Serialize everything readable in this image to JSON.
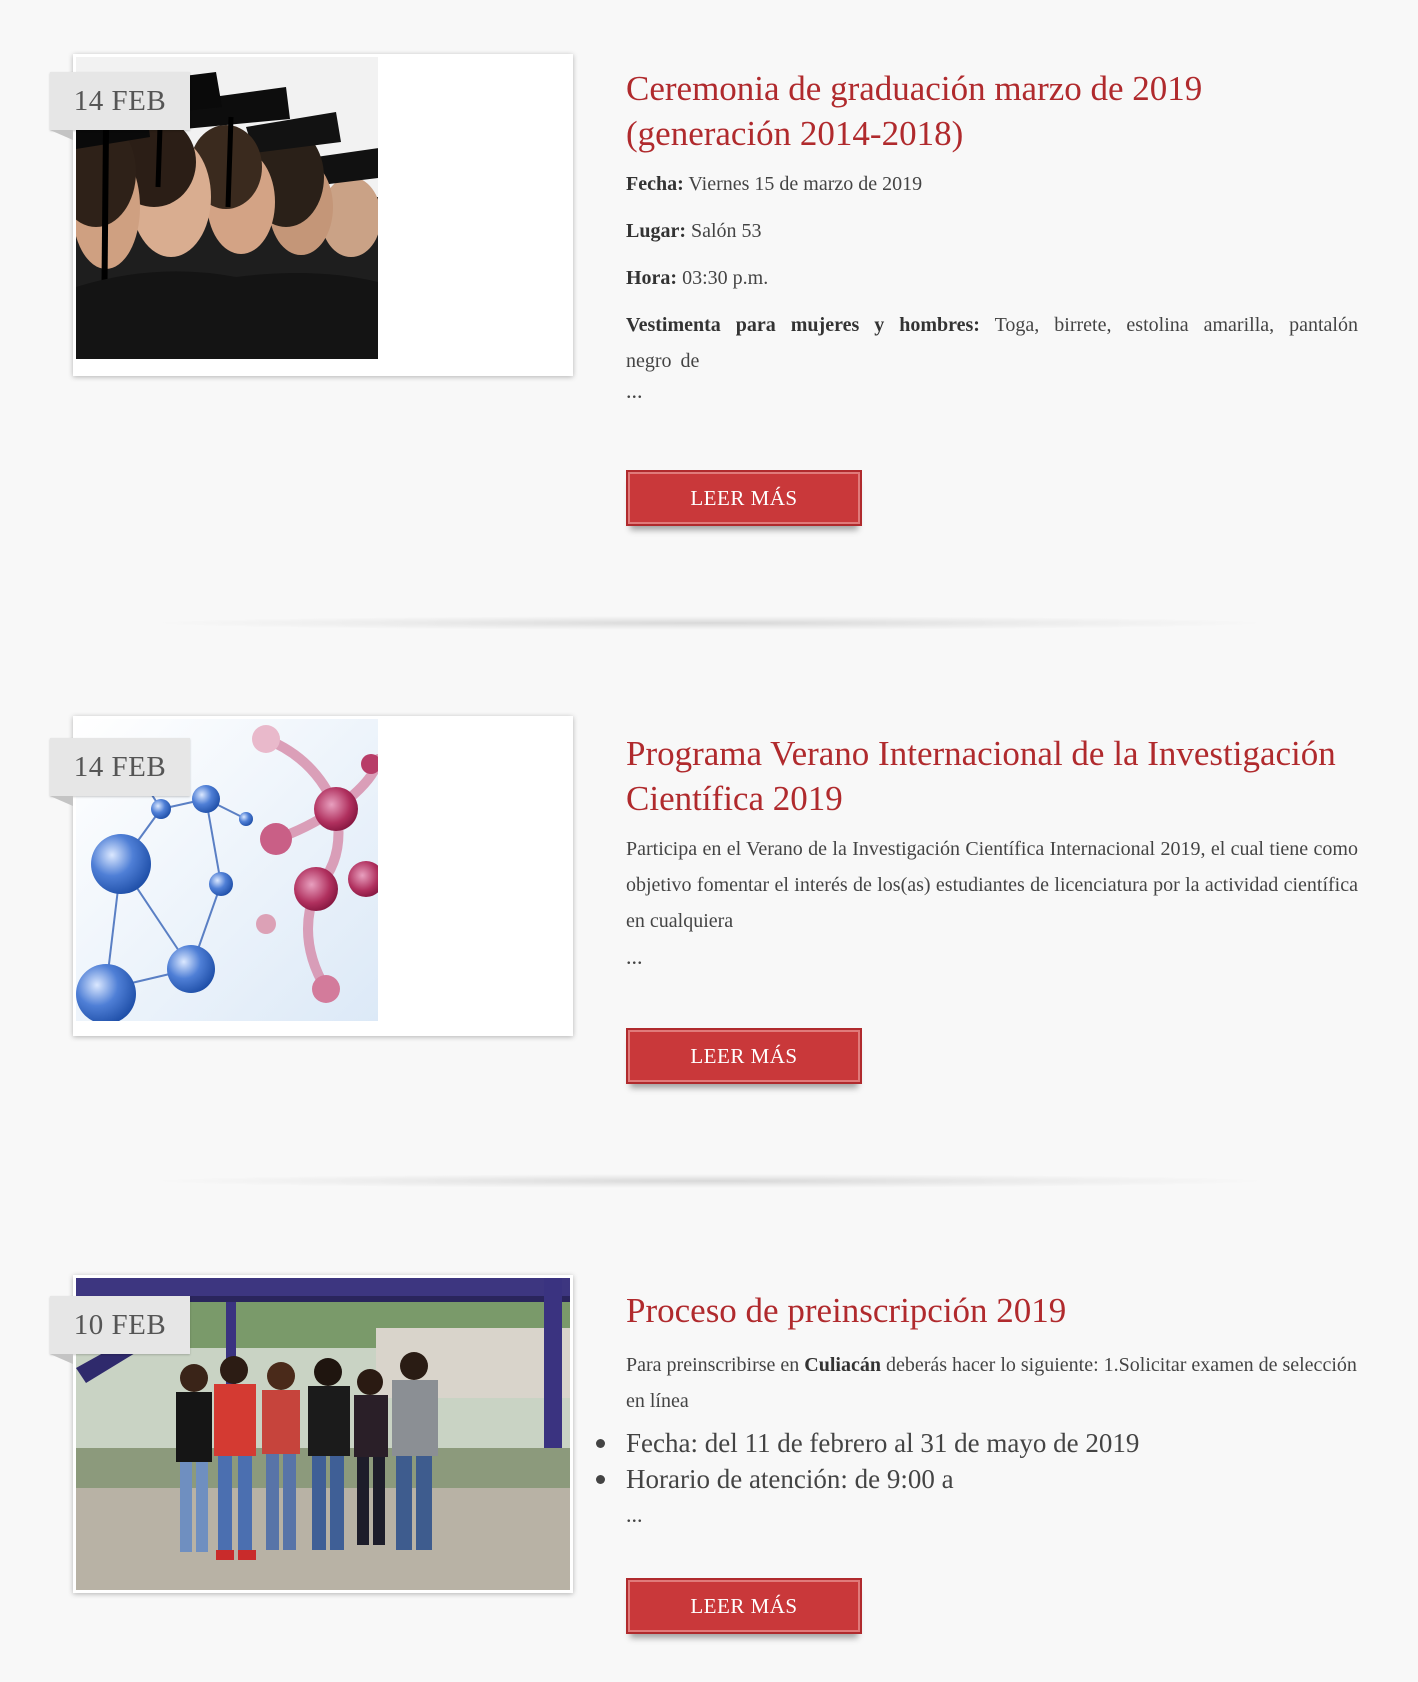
{
  "posts": [
    {
      "date": "14 FEB",
      "title": "Ceremonia de graduación marzo de 2019 (generación 2014-2018)",
      "fields": [
        {
          "label": "Fecha:",
          "value": " Viernes 15 de marzo de 2019"
        },
        {
          "label": "Lugar:",
          "value": " Salón 53"
        },
        {
          "label": "Hora:",
          "value": " 03:30 p.m."
        },
        {
          "label": "Vestimenta para mujeres y hombres:",
          "value": " Toga, birrete, estolina amarilla, pantalón negro de"
        }
      ],
      "ellipsis": "...",
      "button": "LEER MÁS"
    },
    {
      "date": "14 FEB",
      "title": "Programa Verano Internacional de la Investigación Científica 2019",
      "excerpt": "Participa en el Verano de la Investigación Científica Internacional 2019, el cual tiene como objetivo fomentar el interés de los(as) estudiantes de licenciatura por la actividad científica en cualquiera",
      "ellipsis": "...",
      "button": "LEER MÁS"
    },
    {
      "date": "10 FEB",
      "title": "Proceso de preinscripción 2019",
      "excerpt_pre": "Para preinscribirse en ",
      "excerpt_bold": "Culiacán",
      "excerpt_post": " deberás hacer lo siguiente: 1.Solicitar examen de selección en línea",
      "bullets": [
        "Fecha: del 11 de febrero al 31 de mayo de 2019",
        "Horario de atención: de 9:00 a"
      ],
      "ellipsis": "...",
      "button": "LEER MÁS"
    }
  ]
}
